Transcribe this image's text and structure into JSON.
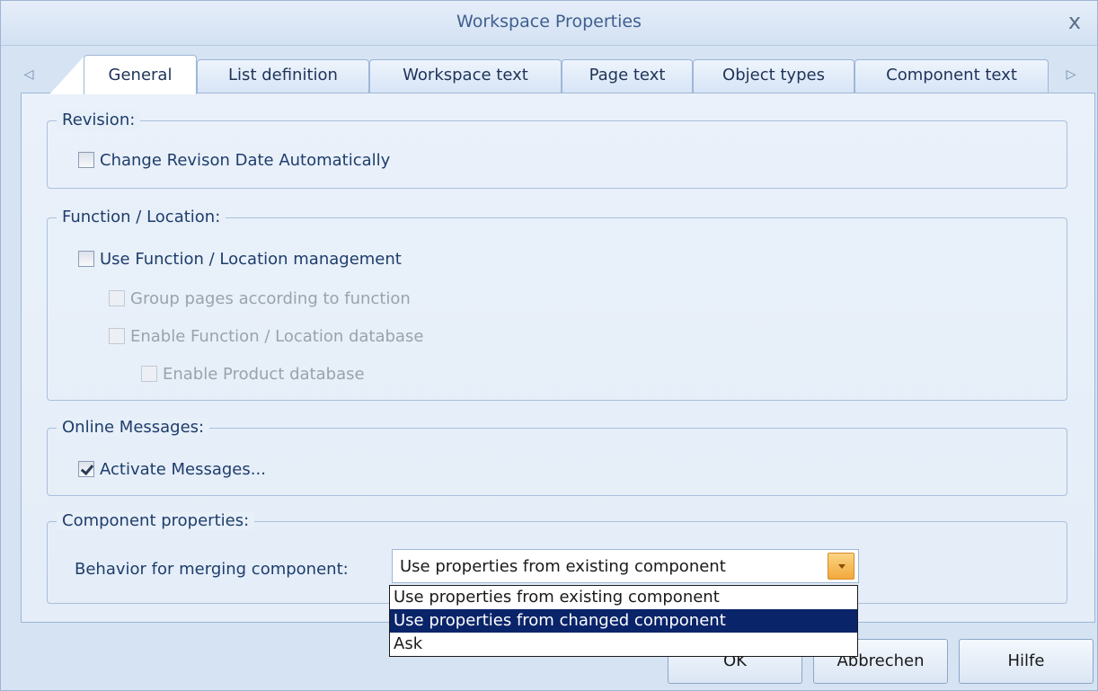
{
  "window": {
    "title": "Workspace Properties",
    "close_glyph": "x"
  },
  "tabs": [
    {
      "label": "General",
      "active": true
    },
    {
      "label": "List definition"
    },
    {
      "label": "Workspace text"
    },
    {
      "label": "Page text"
    },
    {
      "label": "Object types"
    },
    {
      "label": "Component text"
    }
  ],
  "tab_scroll": {
    "left_glyph": "◁",
    "right_glyph": "▷"
  },
  "revision": {
    "legend": "Revision:",
    "change_date_label": "Change Revison Date Automatically",
    "change_date_checked": false
  },
  "function_location": {
    "legend": "Function / Location:",
    "use_mgmt_label": "Use Function / Location management",
    "group_pages_label": "Group pages according to function",
    "enable_db_label": "Enable Function / Location database",
    "enable_product_label": "Enable Product database"
  },
  "online_messages": {
    "legend": "Online Messages:",
    "activate_label": "Activate Messages...",
    "activate_checked": true
  },
  "component_properties": {
    "legend": "Component properties:",
    "behavior_label": "Behavior for merging component:",
    "selected_value": "Use properties from existing component",
    "options": [
      "Use properties from existing component",
      "Use properties from changed component",
      "Ask"
    ],
    "highlighted_index": 1
  },
  "buttons": {
    "ok": "OK",
    "cancel": "Abbrechen",
    "help": "Hilfe"
  },
  "colors": {
    "accent": "#f2a93c",
    "selection": "#0a246a",
    "frame": "#d5e3f3"
  },
  "icons": {
    "close": "close-icon",
    "dropdown": "chevron-down-icon"
  }
}
